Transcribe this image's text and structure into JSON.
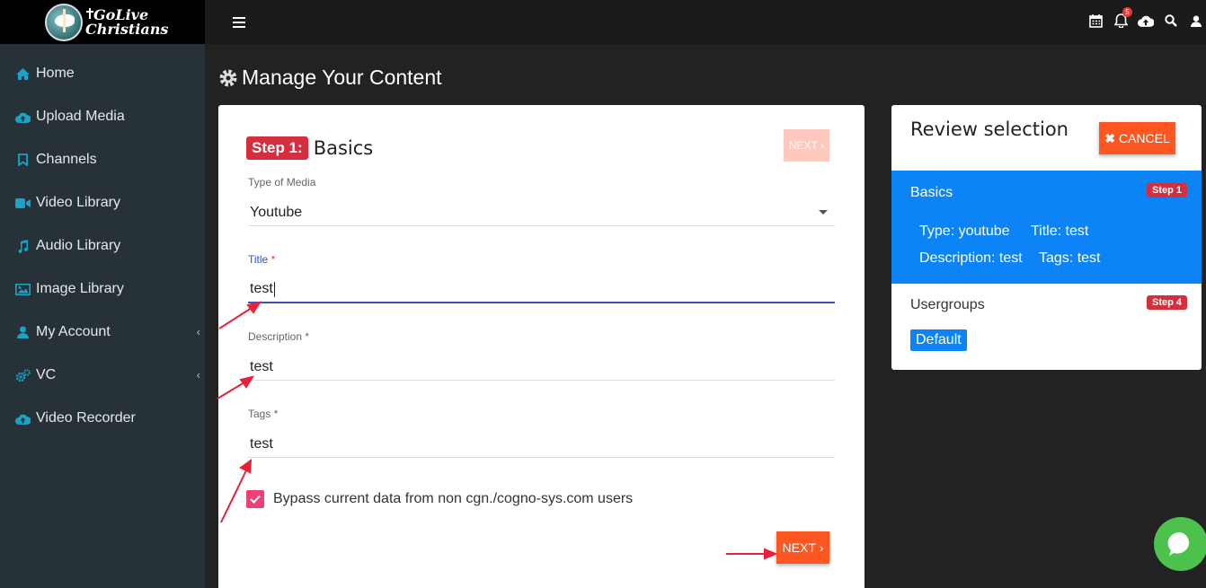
{
  "brand": {
    "line1": "GoLive",
    "line2": "Christians"
  },
  "sidebar": {
    "items": [
      {
        "label": "Home",
        "icon": "home-icon"
      },
      {
        "label": "Upload Media",
        "icon": "cloud-upload-icon"
      },
      {
        "label": "Channels",
        "icon": "bookmark-icon"
      },
      {
        "label": "Video Library",
        "icon": "video-camera-icon"
      },
      {
        "label": "Audio Library",
        "icon": "music-note-icon"
      },
      {
        "label": "Image Library",
        "icon": "image-icon"
      },
      {
        "label": "My Account",
        "icon": "user-icon"
      },
      {
        "label": "VC",
        "icon": "gears-icon"
      },
      {
        "label": "Video Recorder",
        "icon": "cloud-upload-icon"
      }
    ]
  },
  "topbar": {
    "notification_count": "5"
  },
  "page": {
    "title": "Manage Your Content"
  },
  "form": {
    "step_label": "Step 1:",
    "step_title": "Basics",
    "next_label": "NEXT",
    "media_type_label": "Type of Media",
    "media_type_value": "Youtube",
    "title_label": "Title",
    "title_value": "test",
    "description_label": "Description",
    "description_value": "test",
    "tags_label": "Tags",
    "tags_value": "test",
    "required_mark": "*",
    "checkbox_label": "Bypass current data from non cgn./cogno-sys.com users",
    "checkbox_checked": true
  },
  "review": {
    "title": "Review selection",
    "cancel_label": "CANCEL",
    "basics": {
      "title": "Basics",
      "step_badge": "Step 1",
      "type": "Type: youtube",
      "title_value": "Title: test",
      "description": "Description: test",
      "tags": "Tags: test"
    },
    "usergroups": {
      "title": "Usergroups",
      "step_badge": "Step 4",
      "default_tag": "Default"
    }
  },
  "colors": {
    "accent_orange": "#ff5722",
    "step_red": "#d32f3f",
    "selected_blue": "#0d84f5",
    "chat_green": "#4cc24c",
    "checkbox_pink": "#ee3f77"
  }
}
